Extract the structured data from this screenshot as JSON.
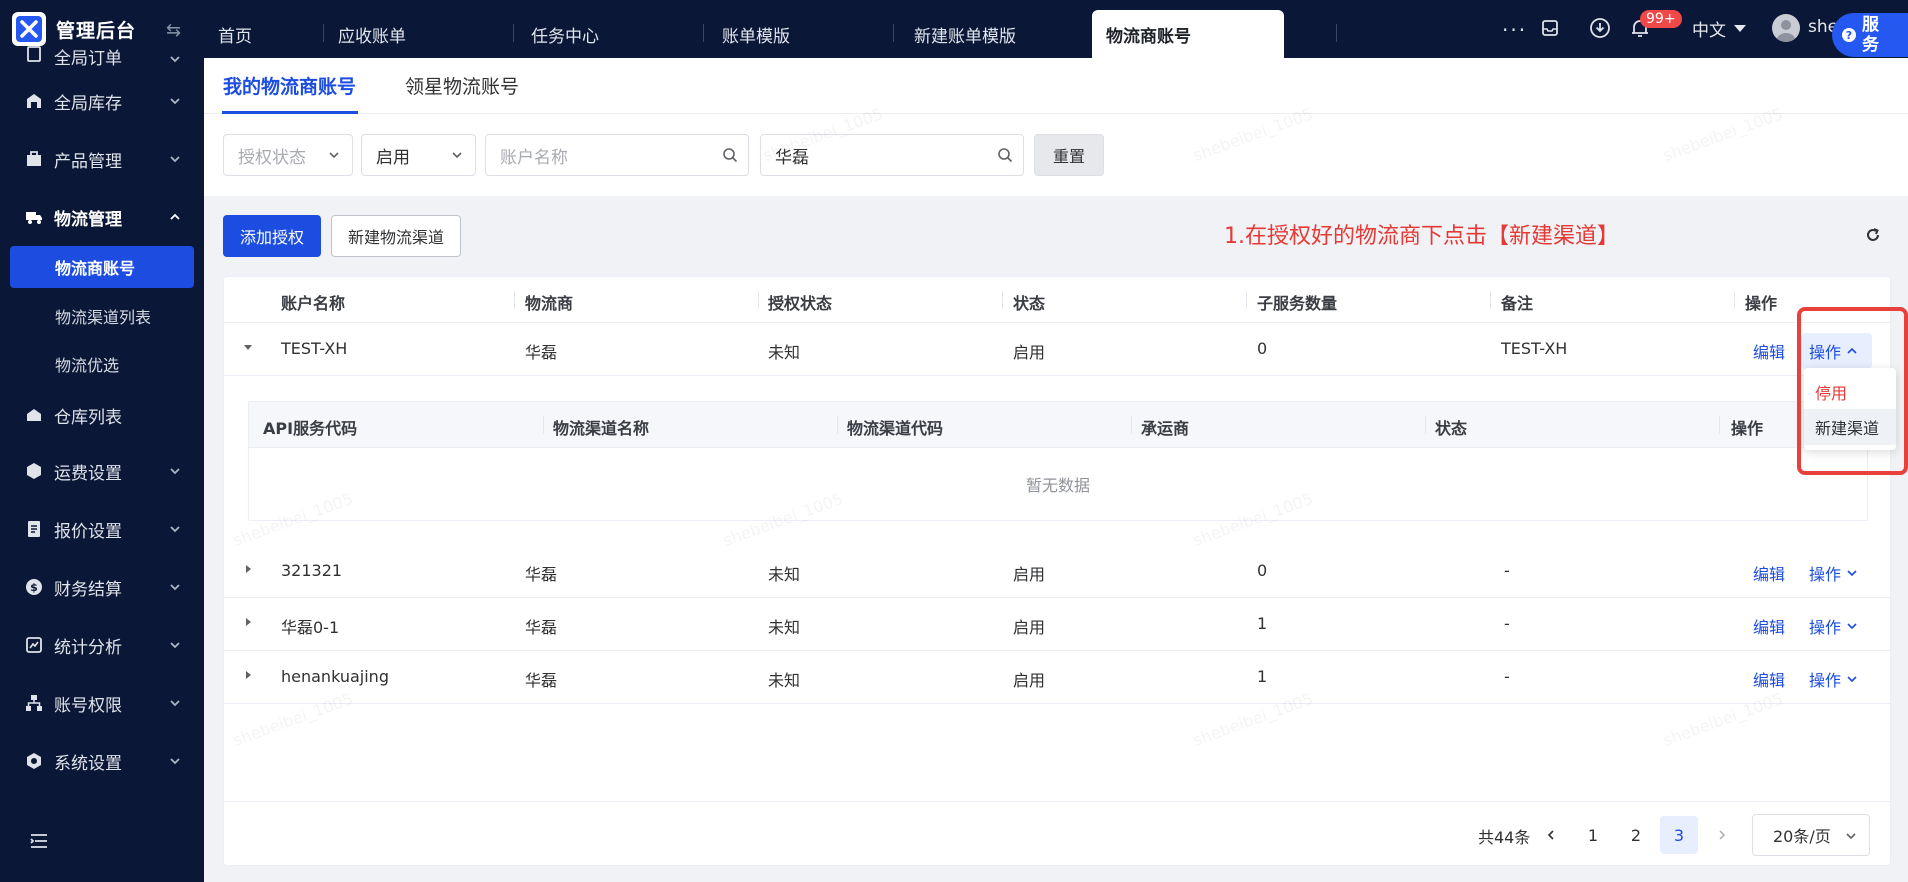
{
  "app": {
    "title": "管理后台",
    "watermark": "shebeibei_1005"
  },
  "sidebar": {
    "items": [
      {
        "label": "全局订单",
        "icon": "order-icon"
      },
      {
        "label": "全局库存",
        "icon": "warehouse-icon"
      },
      {
        "label": "产品管理",
        "icon": "box-icon"
      },
      {
        "label": "物流管理",
        "icon": "truck-icon"
      },
      {
        "label": "仓库列表",
        "icon": "building-icon"
      },
      {
        "label": "运费设置",
        "icon": "freight-icon"
      },
      {
        "label": "报价设置",
        "icon": "quote-icon"
      },
      {
        "label": "财务结算",
        "icon": "dollar-icon"
      },
      {
        "label": "统计分析",
        "icon": "chart-icon"
      },
      {
        "label": "账号权限",
        "icon": "org-icon"
      },
      {
        "label": "系统设置",
        "icon": "settings-icon"
      }
    ],
    "logistics_sub": [
      "物流商账号",
      "物流渠道列表",
      "物流优选"
    ]
  },
  "topbar": {
    "tabs": [
      "首页",
      "应收账单",
      "任务中心",
      "账单模版",
      "新建账单模版",
      "物流商账号"
    ],
    "notification_count": "99+",
    "language": "中文",
    "username": "she",
    "service_label": "服务"
  },
  "page": {
    "subtabs": [
      "我的物流商账号",
      "领星物流账号"
    ],
    "filters": {
      "auth_status_placeholder": "授权状态",
      "status_value": "启用",
      "account_name_placeholder": "账户名称",
      "provider_value": "华磊",
      "reset_label": "重置"
    },
    "actions": {
      "add_auth": "添加授权",
      "new_channel": "新建物流渠道"
    },
    "annotation": "1.在授权好的物流商下点击【新建渠道】",
    "table": {
      "columns": [
        "账户名称",
        "物流商",
        "授权状态",
        "状态",
        "子服务数量",
        "备注",
        "操作"
      ],
      "rows": [
        {
          "account": "TEST-XH",
          "provider": "华磊",
          "auth": "未知",
          "status": "启用",
          "count": "0",
          "note": "TEST-XH"
        },
        {
          "account": "321321",
          "provider": "华磊",
          "auth": "未知",
          "status": "启用",
          "count": "0",
          "note": "-"
        },
        {
          "account": "华磊0-1",
          "provider": "华磊",
          "auth": "未知",
          "status": "启用",
          "count": "1",
          "note": "-"
        },
        {
          "account": "henankuajing",
          "provider": "华磊",
          "auth": "未知",
          "status": "启用",
          "count": "1",
          "note": "-"
        }
      ],
      "edit_label": "编辑",
      "ops_label": "操作",
      "nested_columns": [
        "API服务代码",
        "物流渠道名称",
        "物流渠道代码",
        "承运商",
        "状态",
        "操作"
      ],
      "empty_text": "暂无数据"
    },
    "dropdown": {
      "disable": "停用",
      "new_channel": "新建渠道"
    },
    "pagination": {
      "total": "共44条",
      "pages": [
        "1",
        "2",
        "3"
      ],
      "current": "3",
      "page_size": "20条/页"
    }
  },
  "colors": {
    "sidebar_bg": "#0b1736",
    "primary": "#1c4de0",
    "danger": "#e53935"
  }
}
